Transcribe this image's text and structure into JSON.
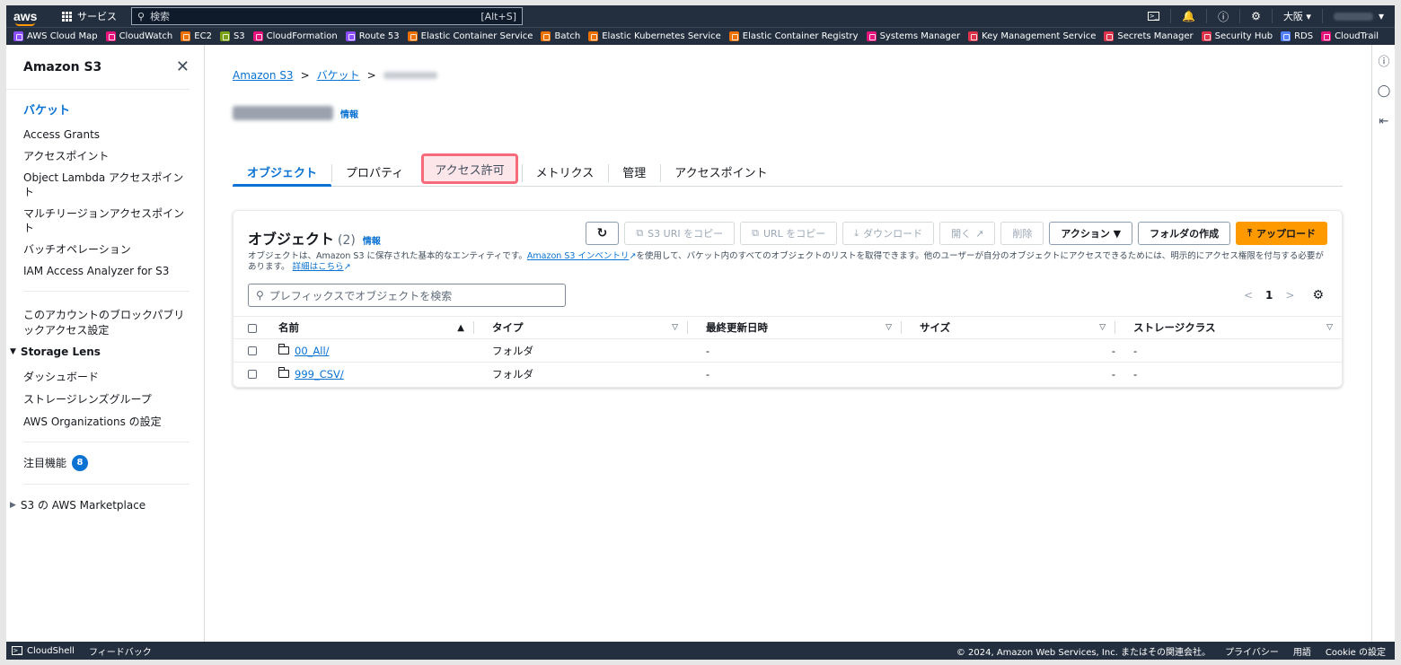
{
  "topnav": {
    "logo": "aws",
    "services_label": "サービス",
    "search_placeholder": "検索",
    "search_shortcut": "[Alt+S]",
    "region": "大阪 ▾",
    "icons": [
      "cloudshell-icon",
      "bell-icon",
      "help-icon",
      "settings-icon"
    ]
  },
  "favorites": [
    {
      "label": "AWS Cloud Map",
      "color": "#8c4fff"
    },
    {
      "label": "CloudWatch",
      "color": "#e7157b"
    },
    {
      "label": "EC2",
      "color": "#ed7100"
    },
    {
      "label": "S3",
      "color": "#7aa116"
    },
    {
      "label": "CloudFormation",
      "color": "#e7157b"
    },
    {
      "label": "Route 53",
      "color": "#8c4fff"
    },
    {
      "label": "Elastic Container Service",
      "color": "#ed7100"
    },
    {
      "label": "Batch",
      "color": "#ed7100"
    },
    {
      "label": "Elastic Kubernetes Service",
      "color": "#ed7100"
    },
    {
      "label": "Elastic Container Registry",
      "color": "#ed7100"
    },
    {
      "label": "Systems Manager",
      "color": "#e7157b"
    },
    {
      "label": "Key Management Service",
      "color": "#dd344c"
    },
    {
      "label": "Secrets Manager",
      "color": "#dd344c"
    },
    {
      "label": "Security Hub",
      "color": "#dd344c"
    },
    {
      "label": "RDS",
      "color": "#527fff"
    },
    {
      "label": "CloudTrail",
      "color": "#e7157b"
    }
  ],
  "sidebar": {
    "title": "Amazon S3",
    "items": [
      "バケット",
      "Access Grants",
      "アクセスポイント",
      "Object Lambda アクセスポイント",
      "マルチリージョンアクセスポイント",
      "バッチオペレーション",
      "IAM Access Analyzer for S3"
    ],
    "block_public": "このアカウントのブロックパブリックアクセス設定",
    "storage_lens": "Storage Lens",
    "lens_items": [
      "ダッシュボード",
      "ストレージレンズグループ",
      "AWS Organizations の設定"
    ],
    "featured": "注目機能",
    "featured_count": "8",
    "marketplace": "S3 の AWS Marketplace"
  },
  "breadcrumb": [
    "Amazon S3",
    "バケット"
  ],
  "page": {
    "info": "情報"
  },
  "tabs": [
    "オブジェクト",
    "プロパティ",
    "アクセス許可",
    "メトリクス",
    "管理",
    "アクセスポイント"
  ],
  "objects": {
    "title": "オブジェクト",
    "count": "(2)",
    "info": "情報",
    "buttons": {
      "copy_s3_uri": "S3 URI をコピー",
      "copy_url": "URL をコピー",
      "download": "ダウンロード",
      "open": "開く",
      "delete": "削除",
      "actions": "アクション ▼",
      "create_folder": "フォルダの作成",
      "upload": "アップロード"
    },
    "desc_1": "オブジェクトは、Amazon S3 に保存された基本的なエンティティです。",
    "desc_link": "Amazon S3 インベントリ",
    "desc_2": "を使用して、バケット内のすべてのオブジェクトのリストを取得できます。他のユーザーが自分のオブジェクトにアクセスできるためには、明示的にアクセス権限を付与する必要があります。",
    "desc_more": "詳細はこちら",
    "search_placeholder": "プレフィックスでオブジェクトを検索",
    "page": "1",
    "columns": [
      "名前",
      "タイプ",
      "最終更新日時",
      "サイズ",
      "ストレージクラス"
    ],
    "rows": [
      {
        "name": "00_All/",
        "type": "フォルダ",
        "modified": "-",
        "size": "-",
        "class": "-"
      },
      {
        "name": "999_CSV/",
        "type": "フォルダ",
        "modified": "-",
        "size": "-",
        "class": "-"
      }
    ]
  },
  "footer": {
    "cloudshell": "CloudShell",
    "feedback": "フィードバック",
    "copyright": "© 2024, Amazon Web Services, Inc. またはその関連会社。",
    "privacy": "プライバシー",
    "terms": "用語",
    "cookie": "Cookie の設定"
  }
}
